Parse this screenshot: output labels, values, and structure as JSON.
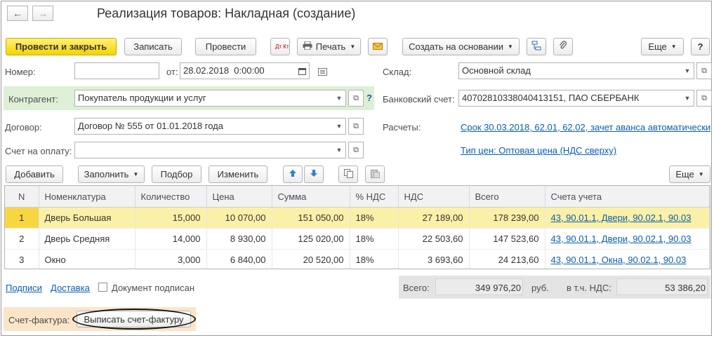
{
  "window": {
    "title": "Реализация товаров: Накладная (создание)"
  },
  "nav": {
    "back_glyph": "←",
    "forward_glyph": "→"
  },
  "toolbar": {
    "post_close": "Провести и закрыть",
    "save": "Записать",
    "post": "Провести",
    "dt_kt": "Дт Кт",
    "print": "Печать",
    "create_based": "Создать на основании",
    "more": "Еще",
    "help": "?"
  },
  "form": {
    "number_label": "Номер:",
    "number_value": "",
    "date_label": "от:",
    "date_value": "28.02.2018  0:00:00",
    "warehouse_label": "Склад:",
    "warehouse_value": "Основной склад",
    "counterparty_label": "Контрагент:",
    "counterparty_value": "Покупатель продукции и услуг",
    "counterparty_help": "?",
    "bank_label": "Банковский счет:",
    "bank_value": "40702810338040413151, ПАО СБЕРБАНК",
    "contract_label": "Договор:",
    "contract_value": "Договор № 555 от 01.01.2018 года",
    "settlements_label": "Расчеты:",
    "settlements_link": "Срок 30.03.2018, 62.01, 62.02, зачет аванса автоматически",
    "invoice_label": "Счет на оплату:",
    "invoice_value": "",
    "price_type_link": "Тип цен: Оптовая цена (НДС сверху)"
  },
  "table_toolbar": {
    "add": "Добавить",
    "fill": "Заполнить",
    "select": "Подбор",
    "change": "Изменить",
    "more": "Еще"
  },
  "table": {
    "columns": [
      "N",
      "Номенклатура",
      "Количество",
      "Цена",
      "Сумма",
      "% НДС",
      "НДС",
      "Всего",
      "Счета учета"
    ],
    "rows": [
      [
        "1",
        "Дверь Большая",
        "15,000",
        "10 070,00",
        "151 050,00",
        "18%",
        "27 189,00",
        "178 239,00",
        "43, 90.01.1, Двери, 90.02.1, 90.03"
      ],
      [
        "2",
        "Дверь Средняя",
        "14,000",
        "8 930,00",
        "125 020,00",
        "18%",
        "22 503,60",
        "147 523,60",
        "43, 90.01.1, Двери, 90.02.1, 90.03"
      ],
      [
        "3",
        "Окно",
        "3,000",
        "6 840,00",
        "20 520,00",
        "18%",
        "3 693,60",
        "24 213,60",
        "43, 90.01.1, Окна, 90.02.1, 90.03"
      ]
    ]
  },
  "footer": {
    "signatures_link": "Подписи",
    "delivery_link": "Доставка",
    "signed_label": "Документ подписан",
    "signed_checked": false,
    "total_label": "Всего:",
    "total_value": "349 976,20",
    "currency": "руб.",
    "vat_label": "в т.ч. НДС:",
    "vat_value": "53 386,20",
    "invoice_label": "Счет-фактура:",
    "invoice_button": "Выписать счет-фактуру"
  },
  "colors": {
    "primary_button": "#f5d300",
    "link": "#0a5fb0",
    "selected_row": "#fbf0a8",
    "counterparty_band": "#ddf0d6",
    "invoice_band": "#fbe5c8"
  }
}
